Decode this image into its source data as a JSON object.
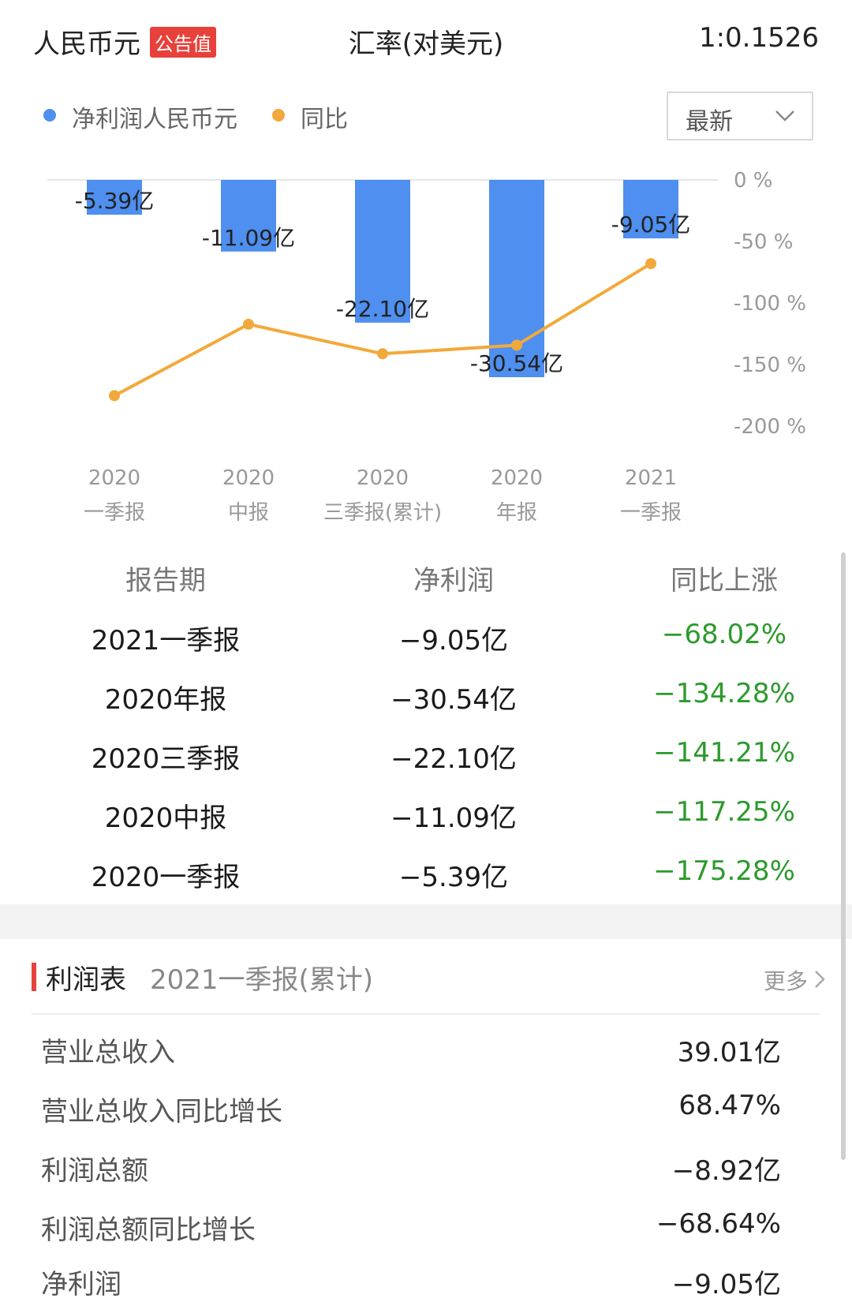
{
  "header": {
    "currency": "人民币元",
    "badge": "公告值",
    "rate_label": "汇率(对美元)",
    "rate_value": "1:0.1526"
  },
  "legend": [
    {
      "label": "净利润人民币元",
      "color": "#4e8ff0"
    },
    {
      "label": "同比",
      "color": "#f2a93b"
    }
  ],
  "dropdown": {
    "label": "最新",
    "icon": "chevron-down-icon"
  },
  "chart_data": {
    "type": "bar",
    "categories": [
      [
        "2020",
        "一季报"
      ],
      [
        "2020",
        "中报"
      ],
      [
        "2020",
        "三季报(累计)"
      ],
      [
        "2020",
        "年报"
      ],
      [
        "2021",
        "一季报"
      ]
    ],
    "series": [
      {
        "name": "净利润人民币元",
        "type": "bar",
        "values": [
          -5.39,
          -11.09,
          -22.1,
          -30.54,
          -9.05
        ],
        "labels": [
          "-5.39亿",
          "-11.09亿",
          "-22.10亿",
          "-30.54亿",
          "-9.05亿"
        ],
        "color": "#4e8ff0"
      },
      {
        "name": "同比",
        "type": "line",
        "values": [
          -175.28,
          -117.25,
          -141.21,
          -134.28,
          -68.02
        ],
        "color": "#f2a93b",
        "axis": "right"
      }
    ],
    "y_right_ticks": [
      "0 %",
      "-50 %",
      "-100 %",
      "-150 %",
      "-200 %"
    ],
    "y_right_range": [
      -200,
      0
    ],
    "bar_range": [
      -30.54,
      0
    ],
    "grid": false,
    "legend_position": "top-left"
  },
  "table": {
    "headers": [
      "报告期",
      "净利润",
      "同比上涨"
    ],
    "rows": [
      [
        "2021一季报",
        "−9.05亿",
        "−68.02%"
      ],
      [
        "2020年报",
        "−30.54亿",
        "−134.28%"
      ],
      [
        "2020三季报",
        "−22.10亿",
        "−141.21%"
      ],
      [
        "2020中报",
        "−11.09亿",
        "−117.25%"
      ],
      [
        "2020一季报",
        "−5.39亿",
        "−175.28%"
      ]
    ]
  },
  "statement": {
    "title": "利润表",
    "period": "2021一季报(累计)",
    "more": "更多",
    "rows": [
      {
        "label": "营业总收入",
        "value": "39.01亿"
      },
      {
        "label": "营业总收入同比增长",
        "value": "68.47%"
      },
      {
        "label": "利润总额",
        "value": "−8.92亿"
      },
      {
        "label": "利润总额同比增长",
        "value": "−68.64%"
      },
      {
        "label": "净利润",
        "value": "−9.05亿"
      }
    ]
  }
}
